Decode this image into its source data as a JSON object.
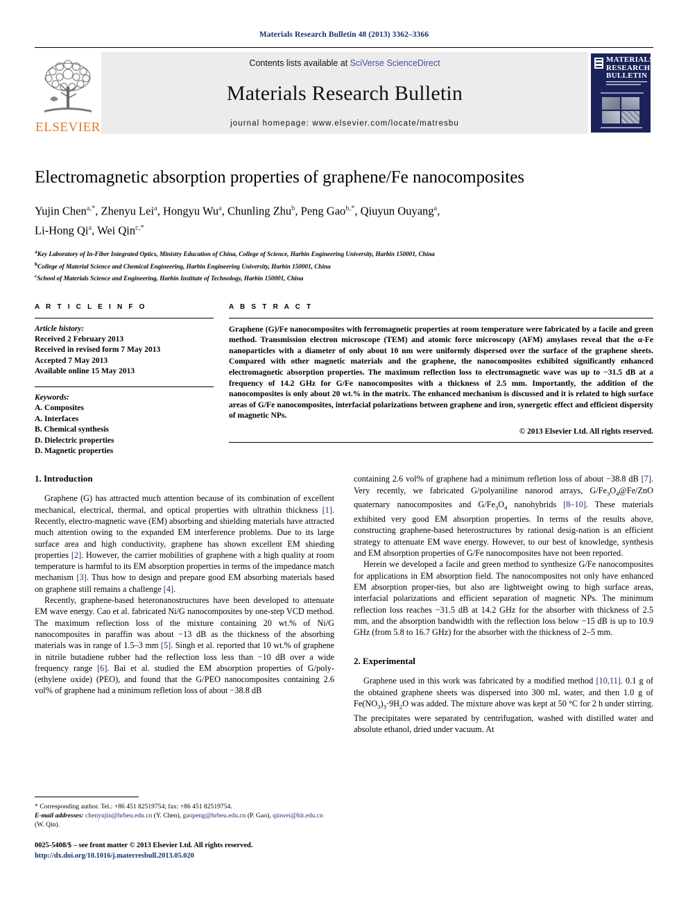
{
  "running_head": "Materials Research Bulletin 48 (2013) 3362–3366",
  "banner": {
    "publisher_wordmark": "ELSEVIER",
    "contents_prefix": "Contents lists available at ",
    "contents_link": "SciVerse ScienceDirect",
    "journal_title": "Materials Research Bulletin",
    "homepage": "journal homepage: www.elsevier.com/locate/matresbu",
    "cover_title": "MATERIALS RESEARCH BULLETIN"
  },
  "title": "Electromagnetic absorption properties of graphene/Fe nanocomposites",
  "authors": "Yujin Chen a,*, Zhenyu Lei a, Hongyu Wu a, Chunling Zhu b, Peng Gao b,*, Qiuyun Ouyang a, Li-Hong Qi a, Wei Qin c,*",
  "affiliations": [
    "Key Laboratory of In-Fiber Integrated Optics, Ministry Education of China, College of Science, Harbin Engineering University, Harbin 150001, China",
    "College of Material Science and Chemical Engineering, Harbin Engineering University, Harbin 150001, China",
    "School of Materials Science and Engineering, Harbin Institute of Technology, Harbin 150001, China"
  ],
  "affiliation_marks": [
    "a",
    "b",
    "c"
  ],
  "article_info": {
    "heading": "A R T I C L E  I N F O",
    "history_label": "Article history:",
    "history": [
      "Received 2 February 2013",
      "Received in revised form 7 May 2013",
      "Accepted 7 May 2013",
      "Available online 15 May 2013"
    ],
    "keywords_label": "Keywords:",
    "keywords": [
      "A. Composites",
      "A. Interfaces",
      "B. Chemical synthesis",
      "D. Dielectric properties",
      "D. Magnetic properties"
    ]
  },
  "abstract": {
    "heading": "A B S T R A C T",
    "text": "Graphene (G)/Fe nanocomposites with ferromagnetic properties at room temperature were fabricated by a facile and green method. Transmission electron microscope (TEM) and atomic force microscopy (AFM) amylases reveal that the α-Fe nanoparticles with a diameter of only about 10 nm were uniformly dispersed over the surface of the graphene sheets. Compared with other magnetic materials and the graphene, the nanocomposites exhibited significantly enhanced electromagnetic absorption properties. The maximum reflection loss to electromagnetic wave was up to −31.5 dB at a frequency of 14.2 GHz for G/Fe nanocomposites with a thickness of 2.5 mm. Importantly, the addition of the nanocomposites is only about 20 wt.% in the matrix. The enhanced mechanism is discussed and it is related to high surface areas of G/Fe nanocomposites, interfacial polarizations between graphene and iron, synergetic effect and efficient dispersity of magnetic NPs.",
    "copyright": "© 2013 Elsevier Ltd. All rights reserved."
  },
  "sections": {
    "introduction_heading": "1. Introduction",
    "experimental_heading": "2. Experimental"
  },
  "body": {
    "intro_p1_a": "Graphene (G) has attracted much attention because of its combination of excellent mechanical, electrical, thermal, and optical properties with ultrathin thickness ",
    "intro_p1_r1": "[1]",
    "intro_p1_b": ". Recently, electro-magnetic wave (EM) absorbing and shielding materials have attracted much attention owing to the expanded EM interference problems. Due to its large surface area and high conductivity, graphene has shown excellent EM shieding properties ",
    "intro_p1_r2": "[2]",
    "intro_p1_c": ". However, the carrier mobilities of graphene with a high quality at room temperature is harmful to its EM absorption properties in terms of the impedance match mechanism ",
    "intro_p1_r3": "[3]",
    "intro_p1_d": ". Thus how to design and prepare good EM absorbing materials based on graphene still remains a challenge ",
    "intro_p1_r4": "[4]",
    "intro_p1_e": ".",
    "intro_p2_a": "Recently, graphene-based heteronanostructures have been developed to attenuate EM wave energy. Cao et al. fabricated Ni/G nanocomposites by one-step VCD method. The maximum reflection loss of the mixture containing 20 wt.% of Ni/G nanocomposites in paraffin was about −13 dB as the thickness of the absorbing materials was in range of 1.5–3 mm ",
    "intro_p2_r1": "[5]",
    "intro_p2_b": ". Singh et al. reported that 10 wt.% of graphene in nitrile butadiene rubber had the reflection loss less than −10 dB over a wide frequency range ",
    "intro_p2_r2": "[6]",
    "intro_p2_c": ". Bai et al. studied the EM absorption properties of G/poly-(ethylene oxide) (PEO), and found that the G/PEO nanocomposites containing 2.6 vol% of graphene had a minimum refletion loss of about −38.8 dB ",
    "intro_p2_r3": "[7]",
    "intro_p2_d": ". Very recently, we fabricated G/polyaniline nanorod arrays, G/Fe",
    "intro_p2_sub1": "3",
    "intro_p2_e": "O",
    "intro_p2_sub2": "4",
    "intro_p2_f": "@Fe/ZnO quaternary nanocomposites and G/Fe",
    "intro_p2_sub3": "3",
    "intro_p2_g": "O",
    "intro_p2_sub4": "4",
    "intro_p2_h": " nanohybrids ",
    "intro_p2_r4": "[8–10]",
    "intro_p2_i": ". These materials exhibited very good EM absorption properties. In terms of the results above, constructing graphene-based heterostructures by rational desig-nation is an efficient strategy to attenuate EM wave energy. However, to our best of knowledge, synthesis and EM absorption properties of G/Fe nanocomposites have not been reported.",
    "intro_p3": "Herein we developed a facile and green method to synthesize G/Fe nanocomposites for applications in EM absorption field. The nanocomposites not only have enhanced EM absorption proper-ties, but also are lightweight owing to high surface areas, interfacial polarizations and efficient separation of magnetic NPs. The minimum reflection loss reaches −31.5 dB at 14.2 GHz for the absorber with thickness of 2.5 mm, and the absorption bandwidth with the reflection loss below −15 dB is up to 10.9 GHz (from 5.8 to 16.7 GHz) for the absorber with the thickness of 2–5 mm.",
    "exp_p1_a": "Graphene used in this work was fabricated by a modified method ",
    "exp_p1_r1": "[10,11]",
    "exp_p1_b": ". 0.1 g of the obtained graphene sheets was dispersed into 300 mL water, and then 1.0 g of Fe(NO",
    "exp_p1_sub1": "3",
    "exp_p1_c": ")",
    "exp_p1_sub2": "3",
    "exp_p1_d": "·9H",
    "exp_p1_sub3": "2",
    "exp_p1_e": "O was added. The mixture above was kept at 50 °C for 2 h under stirring. The precipitates were separated by centrifugation, washed with distilled water and absolute ethanol, dried under vacuum. At"
  },
  "footnotes": {
    "corresponding": "* Corresponding author. Tel.: +86 451 82519754; fax: +86 451 82519754.",
    "email_label": "E-mail addresses:",
    "email1": "chenyujin@hrbeu.edu.cn",
    "email1_name": " (Y. Chen), ",
    "email2": "gaopeng@hrbeu.edu.cn",
    "email2_name": " (P. Gao), ",
    "email3": "qinwei@hit.edu.cn",
    "email3_name": " (W. Qin)."
  },
  "imprint": {
    "line1": "0025-5408/$ – see front matter © 2013 Elsevier Ltd. All rights reserved.",
    "doi": "http://dx.doi.org/10.1016/j.materresbull.2013.05.020"
  },
  "colors": {
    "link": "#1c2c6b",
    "elsevier_orange": "#e87722",
    "cover_navy": "#1b2259",
    "banner_grey": "#ececec"
  }
}
